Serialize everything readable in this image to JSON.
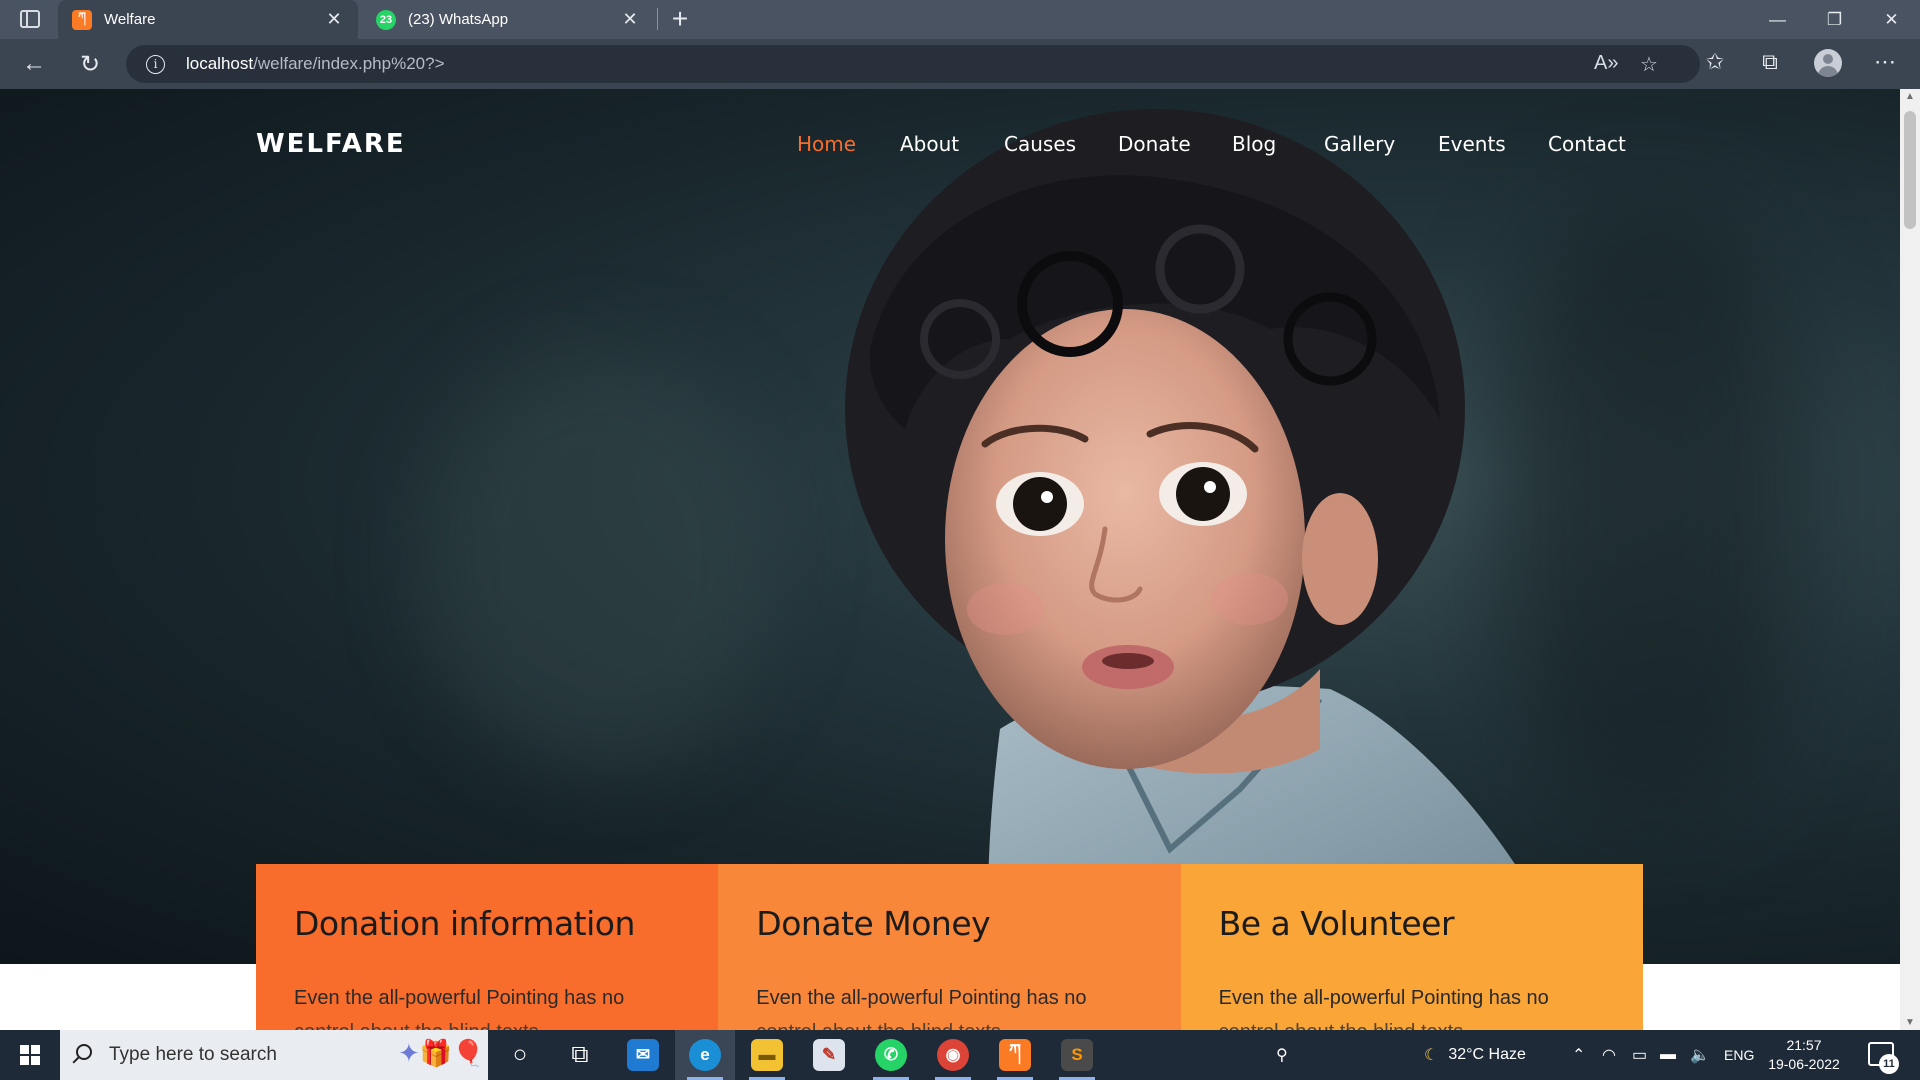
{
  "browser": {
    "tabs": [
      {
        "title": "Welfare",
        "favicon": "xampp-icon",
        "active": true
      },
      {
        "title": "(23) WhatsApp",
        "favicon": "whatsapp-icon",
        "active": false
      }
    ],
    "url_host": "localhost",
    "url_path": "/welfare/index.php%20?>",
    "window_controls": {
      "minimize": "—",
      "restore": "❐",
      "close": "✕"
    }
  },
  "site": {
    "brand": "WELFARE",
    "nav": [
      {
        "label": "Home",
        "active": true
      },
      {
        "label": "About",
        "active": false
      },
      {
        "label": "Causes",
        "active": false
      },
      {
        "label": "Donate",
        "active": false
      },
      {
        "label": "Blog",
        "active": false
      },
      {
        "label": "Gallery",
        "active": false
      },
      {
        "label": "Events",
        "active": false
      },
      {
        "label": "Contact",
        "active": false
      }
    ],
    "cards": [
      {
        "title": "Donation information",
        "text": "Even the all-powerful Pointing has no",
        "text_cut": "control about the blind texts",
        "color": "#f86d2b"
      },
      {
        "title": "Donate Money",
        "text": "Even the all-powerful Pointing has no",
        "text_cut": "control about the blind texts",
        "color": "#f9873a"
      },
      {
        "title": "Be a Volunteer",
        "text": "Even the all-powerful Pointing has no",
        "text_cut": "control about the blind texts",
        "color": "#f9a537"
      }
    ],
    "accent_color": "#f86d2b"
  },
  "taskbar": {
    "search_placeholder": "Type here to search",
    "weather": "32°C  Haze",
    "language": "ENG",
    "time": "21:57",
    "date": "19-06-2022",
    "notification_count": "11"
  }
}
